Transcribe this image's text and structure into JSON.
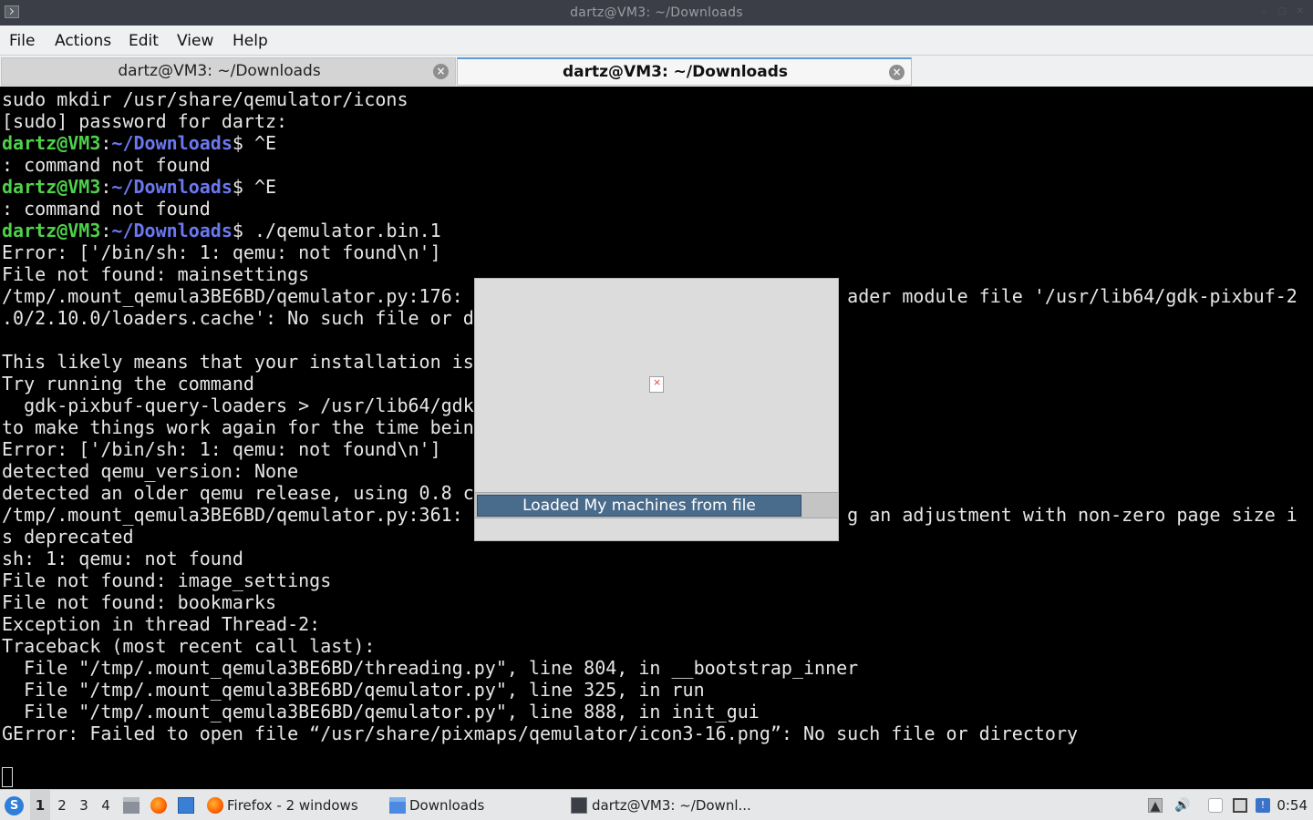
{
  "window": {
    "title": "dartz@VM3: ~/Downloads"
  },
  "menubar": {
    "items": [
      "File",
      "Actions",
      "Edit",
      "View",
      "Help"
    ]
  },
  "tabs": [
    {
      "label": "dartz@VM3: ~/Downloads",
      "active": false
    },
    {
      "label": "dartz@VM3: ~/Downloads",
      "active": true
    }
  ],
  "terminal": {
    "lines": [
      {
        "text": "sudo mkdir /usr/share/qemulator/icons"
      },
      {
        "text": "[sudo] password for dartz:"
      },
      {
        "user": "dartz@VM3",
        "path": "~/Downloads",
        "text": "$ ^E"
      },
      {
        "text": ": command not found"
      },
      {
        "user": "dartz@VM3",
        "path": "~/Downloads",
        "text": "$ ^E"
      },
      {
        "text": ": command not found"
      },
      {
        "user": "dartz@VM3",
        "path": "~/Downloads",
        "text": "$ ./qemulator.bin.1"
      },
      {
        "text": "Error: ['/bin/sh: 1: qemu: not found\\n']"
      },
      {
        "text": "File not found: mainsettings"
      },
      {
        "text": "/tmp/.mount_qemula3BE6BD/qemulator.py:176: G                                 ader module file '/usr/lib64/gdk-pixbuf-2"
      },
      {
        "text": ".0/2.10.0/loaders.cache': No such file or d"
      },
      {
        "text": ""
      },
      {
        "text": "This likely means that your installation is"
      },
      {
        "text": "Try running the command"
      },
      {
        "text": "  gdk-pixbuf-query-loaders > /usr/lib64/gdk"
      },
      {
        "text": "to make things work again for the time bein"
      },
      {
        "text": "Error: ['/bin/sh: 1: qemu: not found\\n']"
      },
      {
        "text": "detected qemu_version: None"
      },
      {
        "text": "detected an older qemu release, using 0.8 c"
      },
      {
        "text": "/tmp/.mount_qemula3BE6BD/qemulator.py:361: G                                 g an adjustment with non-zero page size i"
      },
      {
        "text": "s deprecated"
      },
      {
        "text": "sh: 1: qemu: not found"
      },
      {
        "text": "File not found: image_settings"
      },
      {
        "text": "File not found: bookmarks"
      },
      {
        "text": "Exception in thread Thread-2:"
      },
      {
        "text": "Traceback (most recent call last):"
      },
      {
        "text": "  File \"/tmp/.mount_qemula3BE6BD/threading.py\", line 804, in __bootstrap_inner"
      },
      {
        "text": "  File \"/tmp/.mount_qemula3BE6BD/qemulator.py\", line 325, in run"
      },
      {
        "text": "  File \"/tmp/.mount_qemula3BE6BD/qemulator.py\", line 888, in init_gui"
      },
      {
        "text": "GError: Failed to open file “/usr/share/pixmaps/qemulator/icon3-16.png”: No such file or directory"
      }
    ]
  },
  "dialog": {
    "progress_text": "Loaded My machines from file",
    "progress_fraction": 0.895
  },
  "taskbar": {
    "workspaces": [
      "1",
      "2",
      "3",
      "4"
    ],
    "active_workspace": "1",
    "tasks": [
      {
        "icon": "firefox-icon",
        "label": "Firefox - 2 windows"
      },
      {
        "icon": "folder-icon",
        "label": "Downloads"
      },
      {
        "icon": "terminal-icon",
        "label": "dartz@VM3: ~/Downl..."
      }
    ],
    "clock": "0:54"
  },
  "colors": {
    "prompt_user": "#4fd04a",
    "prompt_path": "#6b78f0",
    "tab_accent": "#5e9bd6",
    "progress": "#4a6c8c"
  }
}
